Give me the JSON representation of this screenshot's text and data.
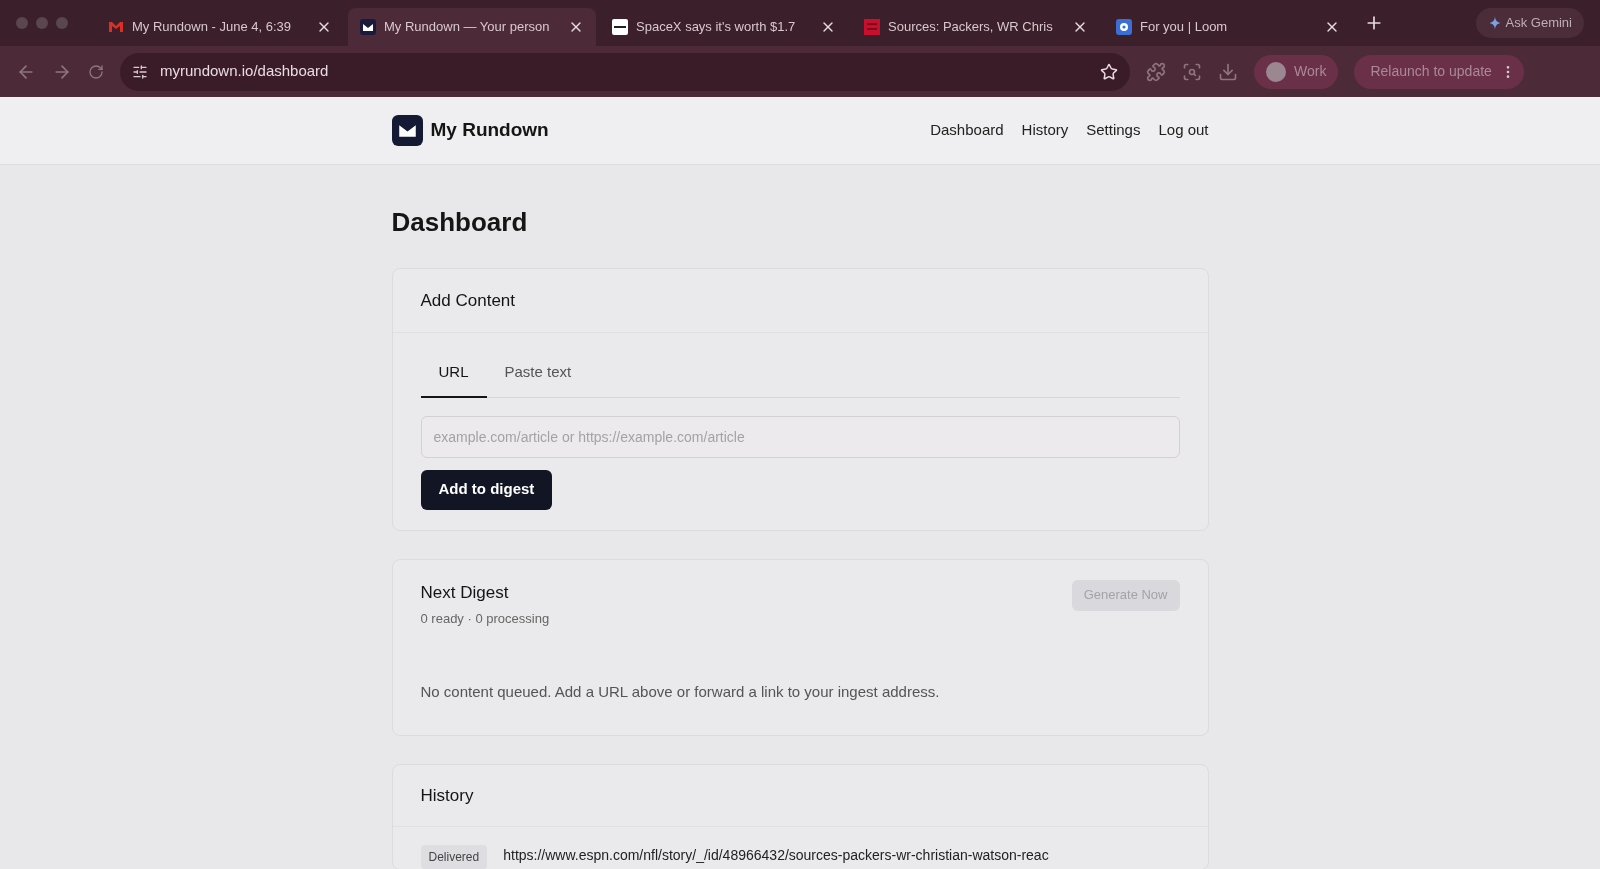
{
  "browser": {
    "tabs": [
      {
        "title": "My Rundown - June 4, 6:39",
        "selected": false
      },
      {
        "title": "My Rundown — Your person",
        "selected": true
      },
      {
        "title": "SpaceX says it's worth $1.7",
        "selected": false
      },
      {
        "title": "Sources: Packers, WR Chris",
        "selected": false
      },
      {
        "title": "For you | Loom",
        "selected": false
      }
    ],
    "ask_button": "Ask Gemini",
    "url": "myrundown.io/dashboard",
    "profile": "Work",
    "relaunch": "Relaunch to update"
  },
  "header": {
    "brand": "My Rundown",
    "nav": [
      "Dashboard",
      "History",
      "Settings",
      "Log out"
    ]
  },
  "page_title": "Dashboard",
  "add_content": {
    "title": "Add Content",
    "tabs": [
      {
        "label": "URL",
        "selected": true
      },
      {
        "label": "Paste text",
        "selected": false
      }
    ],
    "placeholder": "example.com/article or https://example.com/article",
    "button": "Add to digest"
  },
  "next_digest": {
    "title": "Next Digest",
    "subtitle": "0 ready · 0 processing",
    "button": {
      "label": "Generate Now",
      "disabled": true
    },
    "empty": "No content queued. Add a URL above or forward a link to your ingest address."
  },
  "history": {
    "title": "History",
    "rows": [
      {
        "status": "Delivered",
        "url": "https://www.espn.com/nfl/story/_/id/48966432/sources-packers-wr-christian-watson-reac"
      }
    ]
  }
}
